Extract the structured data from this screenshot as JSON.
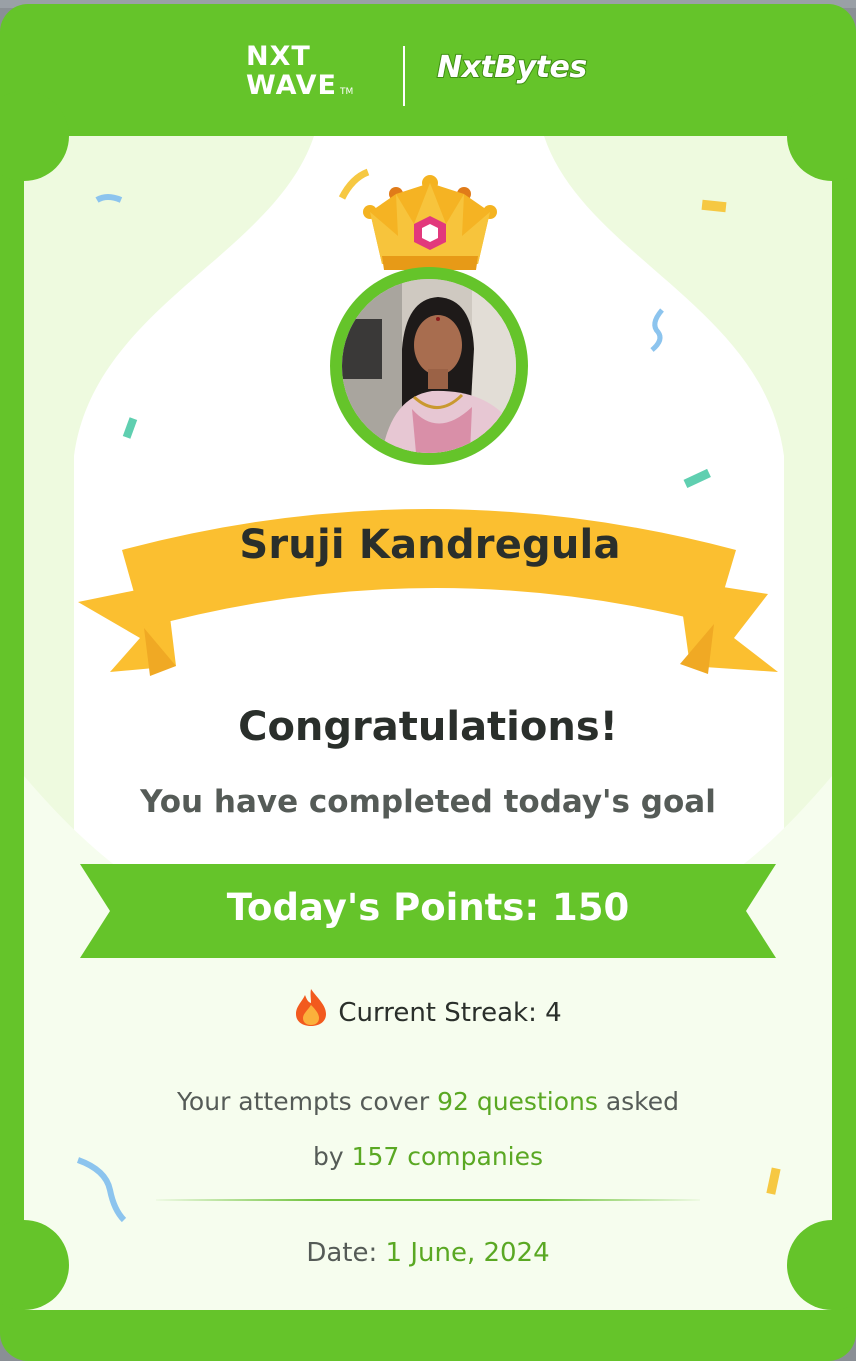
{
  "header": {
    "nxtwave_line1": "NXT",
    "nxtwave_line2": "WAVE",
    "nxtwave_tm": "TM",
    "nxtbytes": "NxtBytes"
  },
  "user": {
    "name": "Sruji Kandregula"
  },
  "message": {
    "title": "Congratulations!",
    "subtitle": "You have completed today's goal"
  },
  "points": {
    "label": "Today's Points: 150"
  },
  "streak": {
    "label": "Current Streak: 4",
    "icon": "flame-icon"
  },
  "attempts": {
    "prefix": "Your attempts cover",
    "questions": "92 questions",
    "middle": "asked",
    "by": "by",
    "companies": "157 companies"
  },
  "date": {
    "label": "Date:",
    "value": "1 June, 2024"
  },
  "colors": {
    "brand_green": "#65c42a",
    "panel_bg": "#eefadf",
    "ribbon_yellow": "#fbbf30",
    "highlight_green": "#5aa823"
  }
}
